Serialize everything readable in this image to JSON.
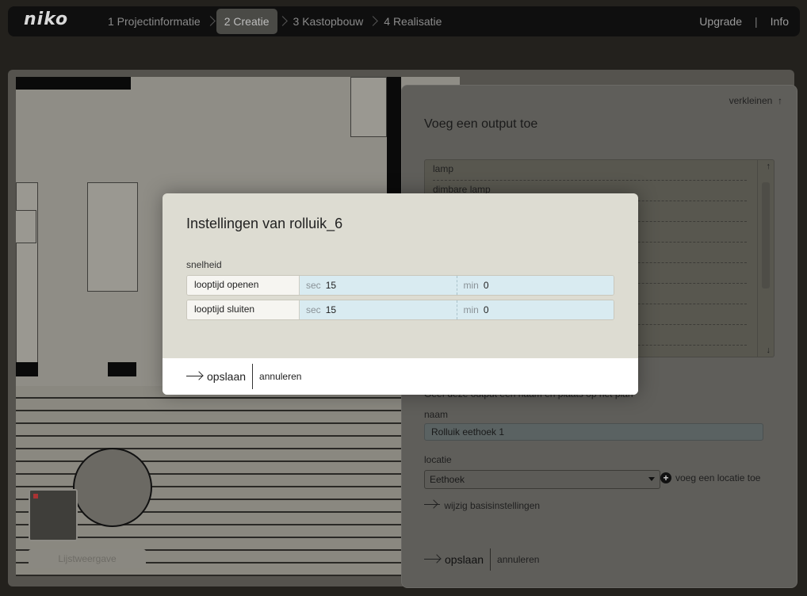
{
  "app": {
    "logo": "niko"
  },
  "nav": {
    "steps": [
      {
        "label": "1 Projectinformatie"
      },
      {
        "label": "2 Creatie",
        "active": true
      },
      {
        "label": "3 Kastopbouw"
      },
      {
        "label": "4 Realisatie"
      }
    ],
    "upgrade": "Upgrade",
    "separator": "|",
    "info": "Info"
  },
  "plan": {
    "list_view": "Lijstweergave"
  },
  "panel": {
    "collapse": "verkleinen",
    "title": "Voeg een output toe",
    "outputs": [
      "lamp",
      "dimbare lamp",
      "",
      "",
      "",
      "",
      "",
      "",
      ""
    ],
    "hint": "Geef deze output een naam en plaats op het plan",
    "name_label": "naam",
    "name_value": "Rolluik eethoek 1",
    "location_label": "locatie",
    "location_value": "Eethoek",
    "add_location": "voeg een locatie toe",
    "basic_settings": "wijzig basisinstellingen",
    "save": "opslaan",
    "cancel": "annuleren"
  },
  "modal": {
    "title": "Instellingen van rolluik_6",
    "section": "snelheid",
    "rows": [
      {
        "label": "looptijd openen",
        "sec_unit": "sec",
        "sec": "15",
        "min_unit": "min",
        "min": "0"
      },
      {
        "label": "looptijd sluiten",
        "sec_unit": "sec",
        "sec": "15",
        "min_unit": "min",
        "min": "0"
      }
    ],
    "save": "opslaan",
    "cancel": "annuleren"
  }
}
